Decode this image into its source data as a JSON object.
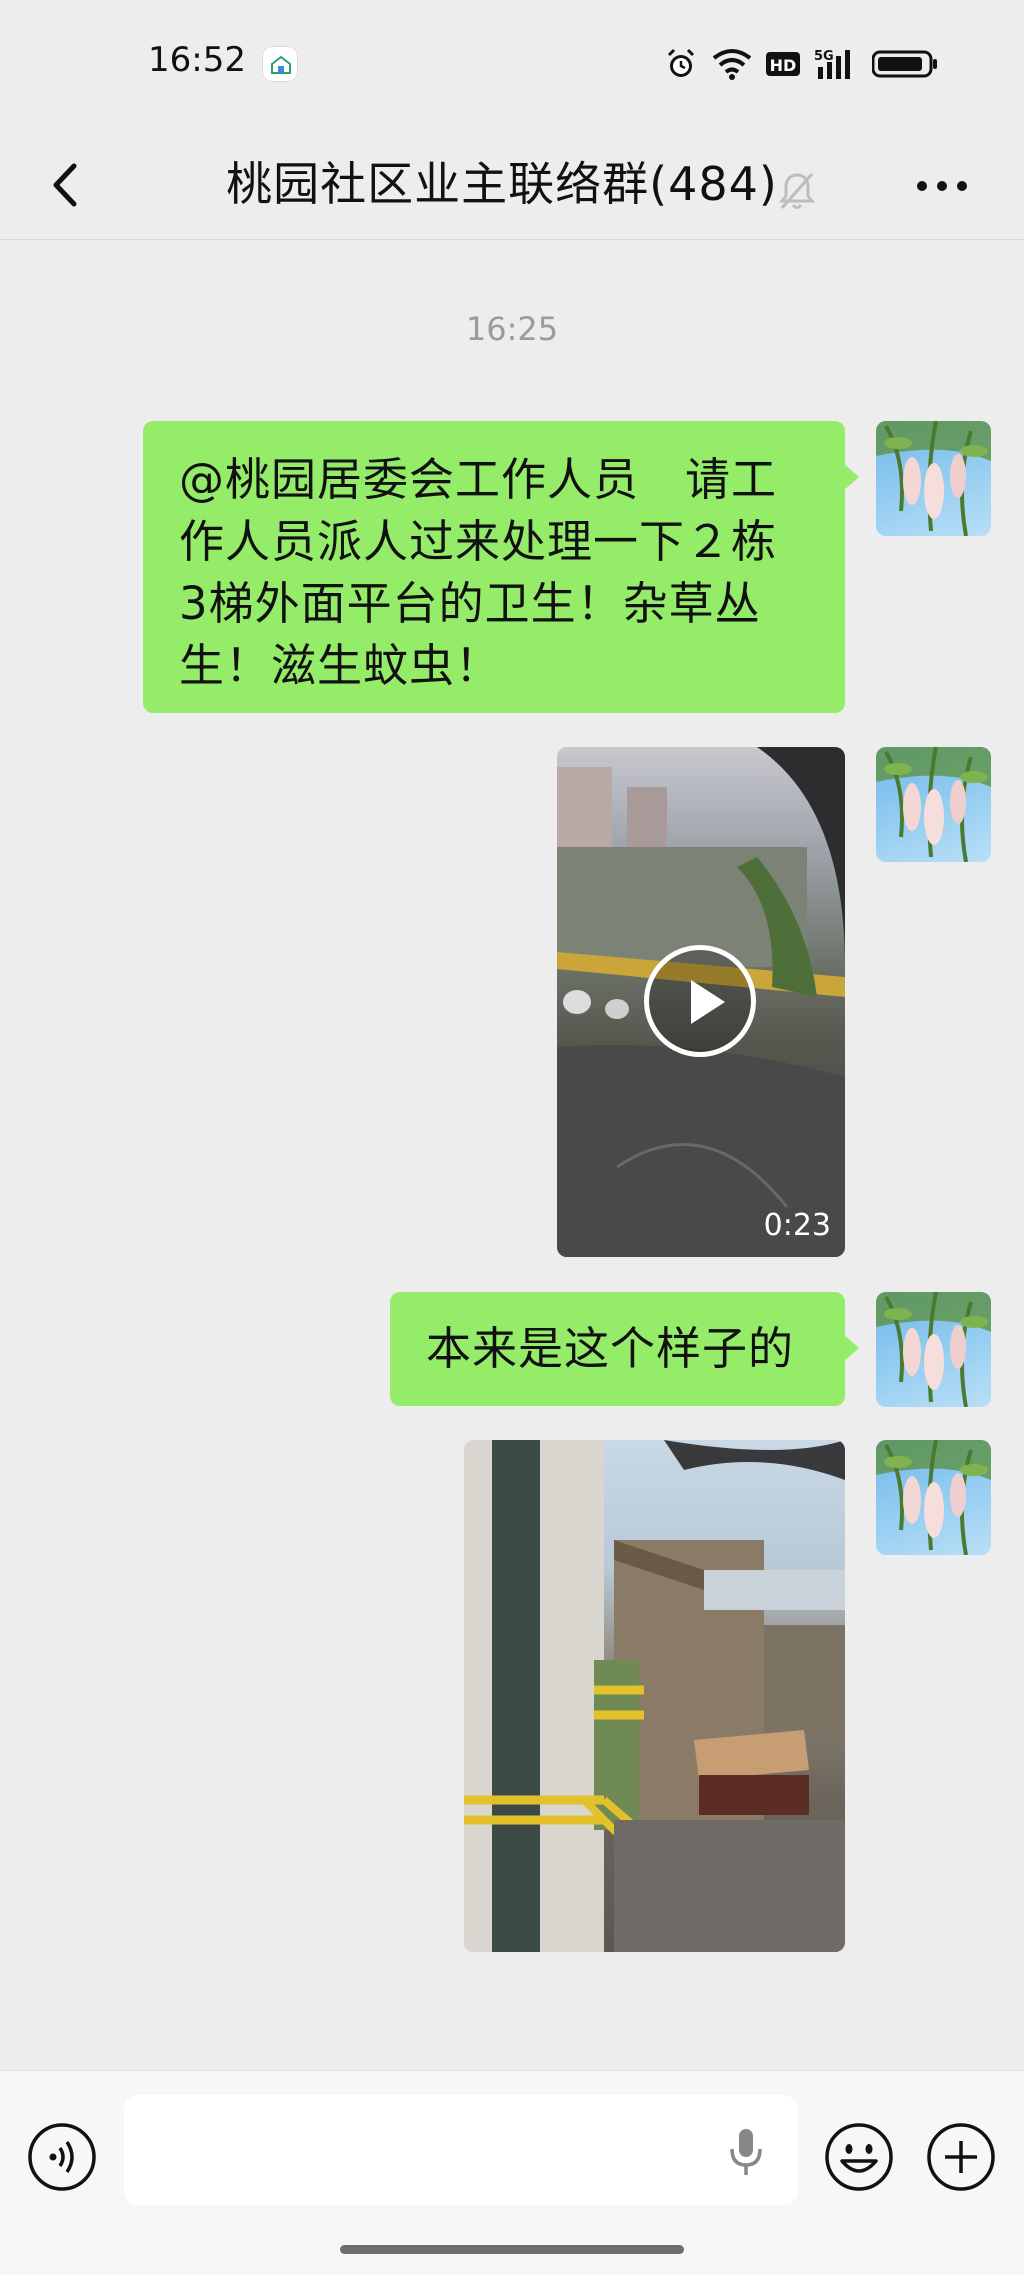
{
  "status_bar": {
    "time": "16:52",
    "app_icon": "home-app-icon",
    "icons": [
      "alarm-icon",
      "wifi-icon",
      "hd-icon",
      "signal-5g-icon",
      "battery-icon"
    ],
    "network_label": "5G",
    "hd_label": "HD"
  },
  "header": {
    "title": "桃园社区业主联络群(484)",
    "back_icon": "chevron-left-icon",
    "mute_icon": "bell-muted-icon",
    "more_icon": "more-dots-icon"
  },
  "chat": {
    "timestamp": "16:25",
    "messages": [
      {
        "type": "text",
        "sender": "me",
        "lines": [
          "@桃园居委会工作人员　请工",
          "作人员派人过来处理一下２栋",
          "3梯外面平台的卫生！杂草丛",
          "生！滋生蚊虫！"
        ]
      },
      {
        "type": "video",
        "sender": "me",
        "duration": "0:23"
      },
      {
        "type": "text",
        "sender": "me",
        "text": "本来是这个样子的"
      },
      {
        "type": "image",
        "sender": "me"
      }
    ]
  },
  "input_bar": {
    "value": "",
    "placeholder": "",
    "voice_icon": "voice-icon",
    "mic_icon": "microphone-icon",
    "emoji_icon": "emoji-icon",
    "plus_icon": "plus-icon"
  },
  "colors": {
    "background": "#ededed",
    "bubble_self": "#95ec69",
    "timestamp": "#9b9b9b",
    "input_bar": "#f7f7f7"
  }
}
